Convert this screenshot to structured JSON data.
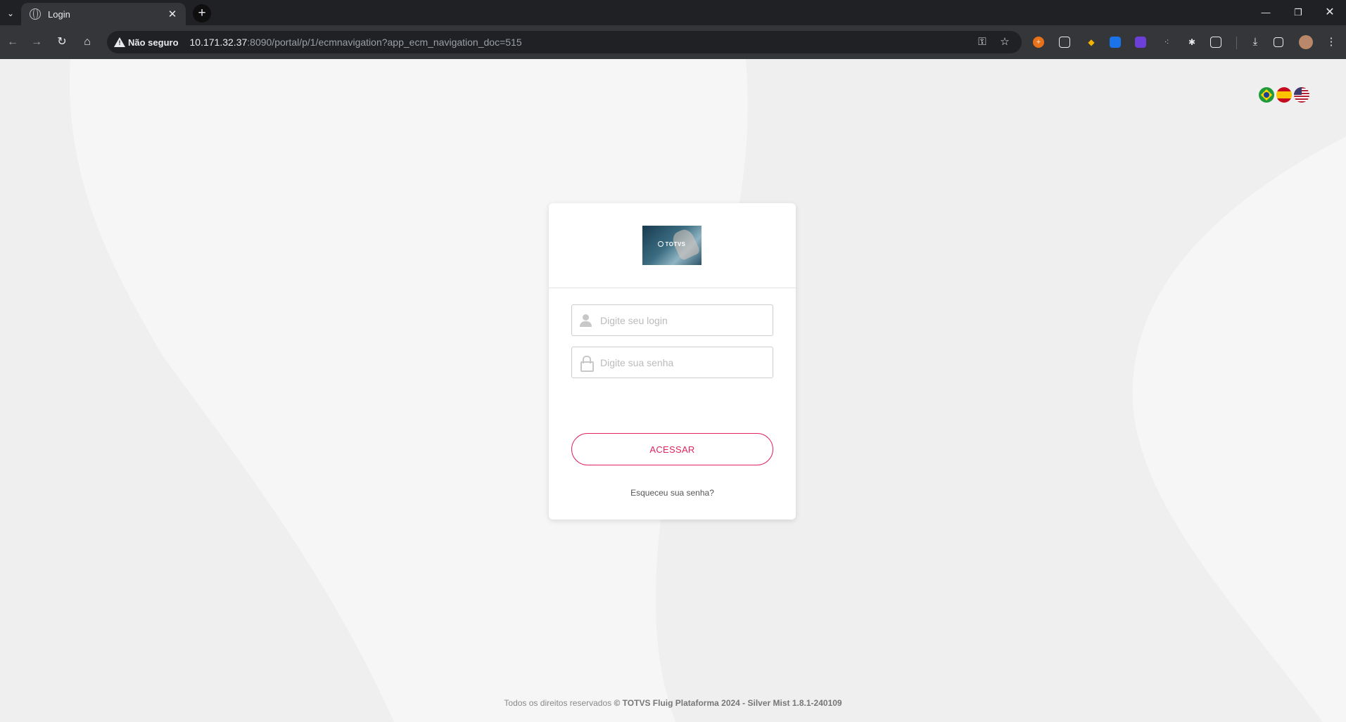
{
  "browser": {
    "tab_title": "Login",
    "security_label": "Não seguro",
    "url_host": "10.171.32.37",
    "url_rest": ":8090/portal/p/1/ecmnavigation?app_ecm_navigation_doc=515",
    "icons": [
      "back-icon",
      "forward-icon",
      "reload-icon",
      "home-icon",
      "key-icon",
      "star-icon",
      "extensions-icon",
      "downloads-icon",
      "sidepanel-icon",
      "profile-avatar",
      "menu-icon"
    ]
  },
  "page": {
    "languages": [
      "pt-BR",
      "es",
      "en-US"
    ],
    "logo_text": "TOTVS",
    "login_placeholder": "Digite seu login",
    "password_placeholder": "Digite sua senha",
    "submit_label": "ACESSAR",
    "forgot_label": "Esqueceu sua senha?",
    "footer_prefix": "Todos os direitos reservados",
    "footer_bold": "© TOTVS Fluig Plataforma 2024 - Silver Mist 1.8.1-240109",
    "accent_color": "#e0245e"
  }
}
